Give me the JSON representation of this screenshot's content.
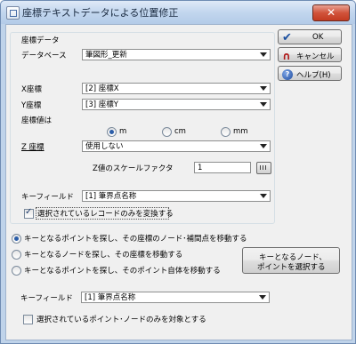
{
  "window": {
    "title": "座標テキストデータによる位置修正",
    "close_glyph": "✕"
  },
  "coord_group": {
    "label": "座標データ",
    "database_label": "データベース",
    "database_value": "筆図形_更新",
    "x_label": "X座標",
    "x_value": "[2] 座標X",
    "y_label": "Y座標",
    "y_value": "[3] 座標Y",
    "unit_label": "座標値は",
    "units": [
      {
        "label": "m",
        "selected": true
      },
      {
        "label": "cm",
        "selected": false
      },
      {
        "label": "mm",
        "selected": false
      }
    ],
    "z_label": "Z 座標",
    "z_value": "使用しない",
    "z_scale_label": "Z値のスケールファクタ",
    "z_scale_value": "1",
    "key_field_label": "キーフィールド",
    "key_field_value": "[1] 筆界点名称",
    "selected_only_label": "選択されているレコードのみを変換する",
    "selected_only_checked": true
  },
  "move_options": [
    {
      "label": "キーとなるポイントを探し、その座標のノード･補間点を移動する",
      "selected": true
    },
    {
      "label": "キーとなるノードを探し、その座標を移動する",
      "selected": false
    },
    {
      "label": "キーとなるポイントを探し、そのポイント自体を移動する",
      "selected": false
    }
  ],
  "select_key_button": {
    "line1": "キーとなるノード、",
    "line2": "ポイントを選択する"
  },
  "bottom": {
    "key_field_label": "キーフィールド",
    "key_field_value": "[1] 筆界点名称",
    "target_only_label": "選択されているポイント･ノードのみを対象とする",
    "target_only_checked": false
  },
  "buttons": {
    "ok": "OK",
    "cancel": "キャンセル",
    "help": "ヘルプ(H)",
    "ok_icon": "check-icon",
    "cancel_icon": "undo-icon",
    "help_icon": "help-icon"
  },
  "colors": {
    "title_bar": "#c2d6ee",
    "close_button": "#c94a32",
    "dialog_bg": "#f0f0f0"
  }
}
